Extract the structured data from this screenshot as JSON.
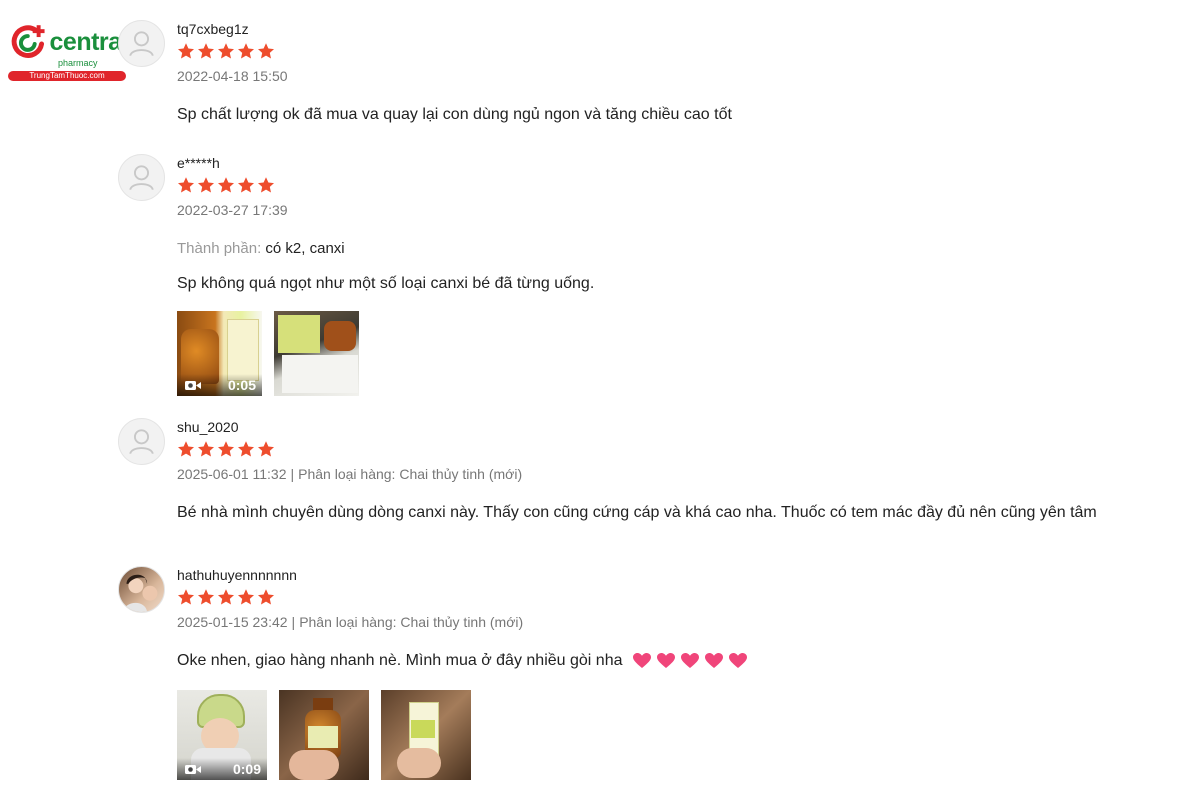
{
  "brand": {
    "name": "central",
    "sub": "pharmacy",
    "site": "TrungTamThuoc.com",
    "colors": {
      "green": "#1a8f3c",
      "red": "#e0252b"
    }
  },
  "colors": {
    "star": "#ee4d2d",
    "heart": "#f0457a"
  },
  "reviews": [
    {
      "username": "tq7cxbeg1z",
      "rating": 5,
      "date": "2022-04-18 15:50",
      "variation": "",
      "text": "Sp chất lượng ok đã mua va quay lại con dùng ngủ ngon và tăng chiều cao tốt"
    },
    {
      "username": "e*****h",
      "rating": 5,
      "date": "2022-03-27 17:39",
      "spec_label": "Thành phần:",
      "spec_value": "có k2,  canxi",
      "text": "Sp không quá ngọt như một số loại canxi bé đã từng uống.",
      "media": [
        {
          "type": "video",
          "duration": "0:05",
          "icon": "video-camera-icon"
        },
        {
          "type": "image"
        }
      ]
    },
    {
      "username": "shu_2020",
      "rating": 5,
      "date": "2025-06-01 11:32",
      "variation_label": "Phân loại hàng:",
      "variation": "Chai thủy tinh (mới)",
      "text": "Bé nhà mình chuyên dùng dòng canxi này. Thấy con cũng cứng cáp và khá cao nha. Thuốc có tem mác đầy đủ nên cũng yên tâm"
    },
    {
      "username": "hathuhuyennnnnnn",
      "rating": 5,
      "date": "2025-01-15 23:42",
      "variation_label": "Phân loại hàng:",
      "variation": "Chai thủy tinh (mới)",
      "text": "Oke nhen, giao hàng nhanh nè. Mình mua ở đây nhiều gòi nha",
      "emoji": [
        "heart-icon",
        "heart-icon",
        "heart-icon",
        "heart-icon",
        "heart-icon"
      ],
      "media": [
        {
          "type": "video",
          "duration": "0:09",
          "icon": "video-camera-icon"
        },
        {
          "type": "image"
        },
        {
          "type": "image"
        }
      ]
    }
  ]
}
